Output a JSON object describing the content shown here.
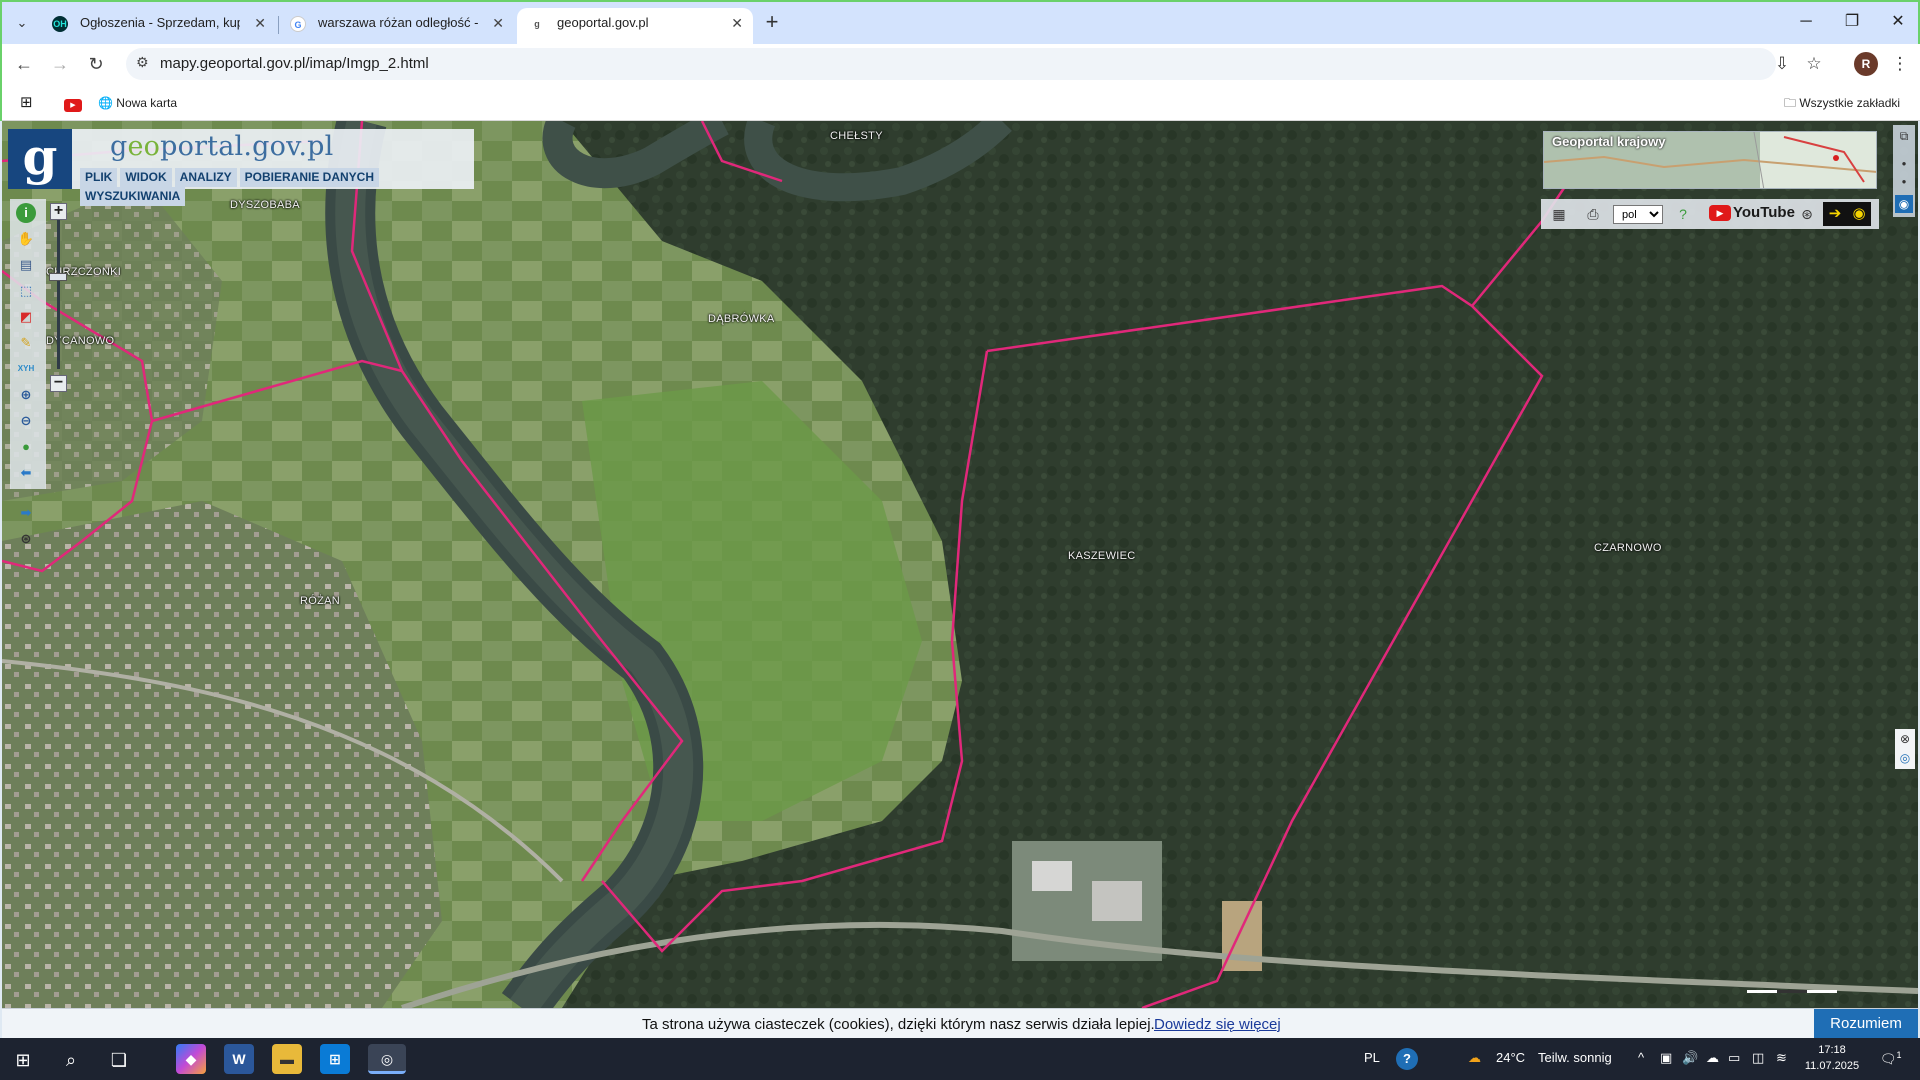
{
  "browser": {
    "tabs": [
      {
        "title": "Ogłoszenia - Sprzedam, kupię n",
        "favicon": "olx-icon",
        "active": false
      },
      {
        "title": "warszawa różan odległość - Szu",
        "favicon": "google-icon",
        "active": false
      },
      {
        "title": "geoportal.gov.pl",
        "favicon": "geoportal-icon",
        "active": true
      }
    ],
    "url": "mapy.geoportal.gov.pl/imap/Imgp_2.html",
    "profile_initial": "R",
    "bookmarks": [
      {
        "label": "Nowa karta",
        "icon": "globe-icon"
      }
    ],
    "all_bookmarks_label": "Wszystkie zakładki"
  },
  "geoportal": {
    "logo_letter": "g",
    "logo_text_prefix": "g",
    "logo_text_accent": "eo",
    "logo_text_suffix": "portal.gov.pl",
    "menu": [
      "PLIK",
      "WIDOK",
      "ANALIZY",
      "POBIERANIE DANYCH",
      "WYSZUKIWANIA"
    ],
    "overview_title": "Geoportal krajowy",
    "language": "pol",
    "language_options": [
      "pol"
    ],
    "youtube_label": "YouTube"
  },
  "map": {
    "places": [
      {
        "name": "CHEŁSTY"
      },
      {
        "name": "DYSZOBABA"
      },
      {
        "name": "CHRZCZONKI"
      },
      {
        "name": "DYCANOWO"
      },
      {
        "name": "DĄBRÓWKA"
      },
      {
        "name": "RÓŻAN"
      },
      {
        "name": "KASZEWIEC"
      },
      {
        "name": "CZARNOWO"
      }
    ],
    "boundary_color": "#e0287a"
  },
  "cookie": {
    "text": "Ta strona używa ciasteczek (cookies), dzięki którym nasz serwis działa lepiej.",
    "link": "Dowiedz się więcej",
    "button": "Rozumiem"
  },
  "taskbar": {
    "language": "PL",
    "weather_temp": "24°C",
    "weather_desc": "Teilw. sonnig",
    "time": "17:18",
    "date": "11.07.2025",
    "notification_count": "1"
  }
}
